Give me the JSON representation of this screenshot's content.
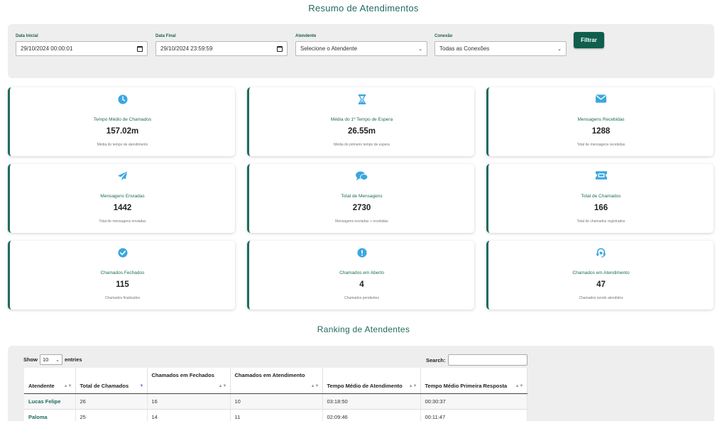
{
  "page_title": "Resumo de Atendimentos",
  "filters": {
    "start_label": "Data Inicial",
    "start_value": "29/10/2024 00:00:01",
    "end_label": "Data Final",
    "end_value": "29/10/2024 23:59:59",
    "agent_label": "Atendente",
    "agent_value": "Selecione o Atendente",
    "connection_label": "Conexão",
    "connection_value": "Todas as Conexões",
    "filter_button": "Filtrar"
  },
  "accent_color": "#1f6b5c",
  "icon_color": "#3aa7df",
  "cards": [
    {
      "icon": "clock-icon",
      "label": "Tempo Médio de Chamados",
      "value": "157.02m",
      "sub": "Média do tempo de atendimento"
    },
    {
      "icon": "hourglass-icon",
      "label": "Média do 1º Tempo de Espera",
      "value": "26.55m",
      "sub": "Média do primeiro tempo de espera"
    },
    {
      "icon": "envelope-icon",
      "label": "Mensagens Recebidas",
      "value": "1288",
      "sub": "Total de mensagens recebidas"
    },
    {
      "icon": "paper-plane-icon",
      "label": "Mensagens Enviadas",
      "value": "1442",
      "sub": "Total de mensagens enviadas"
    },
    {
      "icon": "chat-bubbles-icon",
      "label": "Total de Mensagens",
      "value": "2730",
      "sub": "Mensagens enviadas + recebidas"
    },
    {
      "icon": "ticket-icon",
      "label": "Total de Chamados",
      "value": "166",
      "sub": "Total de chamados registrados"
    },
    {
      "icon": "check-circle-icon",
      "label": "Chamados Fechados",
      "value": "115",
      "sub": "Chamados finalizados"
    },
    {
      "icon": "exclamation-circle-icon",
      "label": "Chamados em Aberto",
      "value": "4",
      "sub": "Chamados pendentes"
    },
    {
      "icon": "headset-icon",
      "label": "Chamados em Atendimento",
      "value": "47",
      "sub": "Chamados sendo atendidos"
    }
  ],
  "ranking": {
    "title": "Ranking de Atendentes",
    "show_label": "Show",
    "entries_value": "10",
    "entries_label": "entries",
    "search_label": "Search:",
    "columns": [
      "Atendente",
      "Total de Chamados",
      "Chamados em Fechados",
      "Chamados em Atendimento",
      "Tempo Médio de Atendimento",
      "Tempo Médio Primeira Resposta"
    ],
    "rows": [
      [
        "Lucas Felipe",
        "26",
        "16",
        "10",
        "03:18:50",
        "00:30:37"
      ],
      [
        "Paloma",
        "25",
        "14",
        "11",
        "02:09:46",
        "00:11:47"
      ]
    ]
  }
}
